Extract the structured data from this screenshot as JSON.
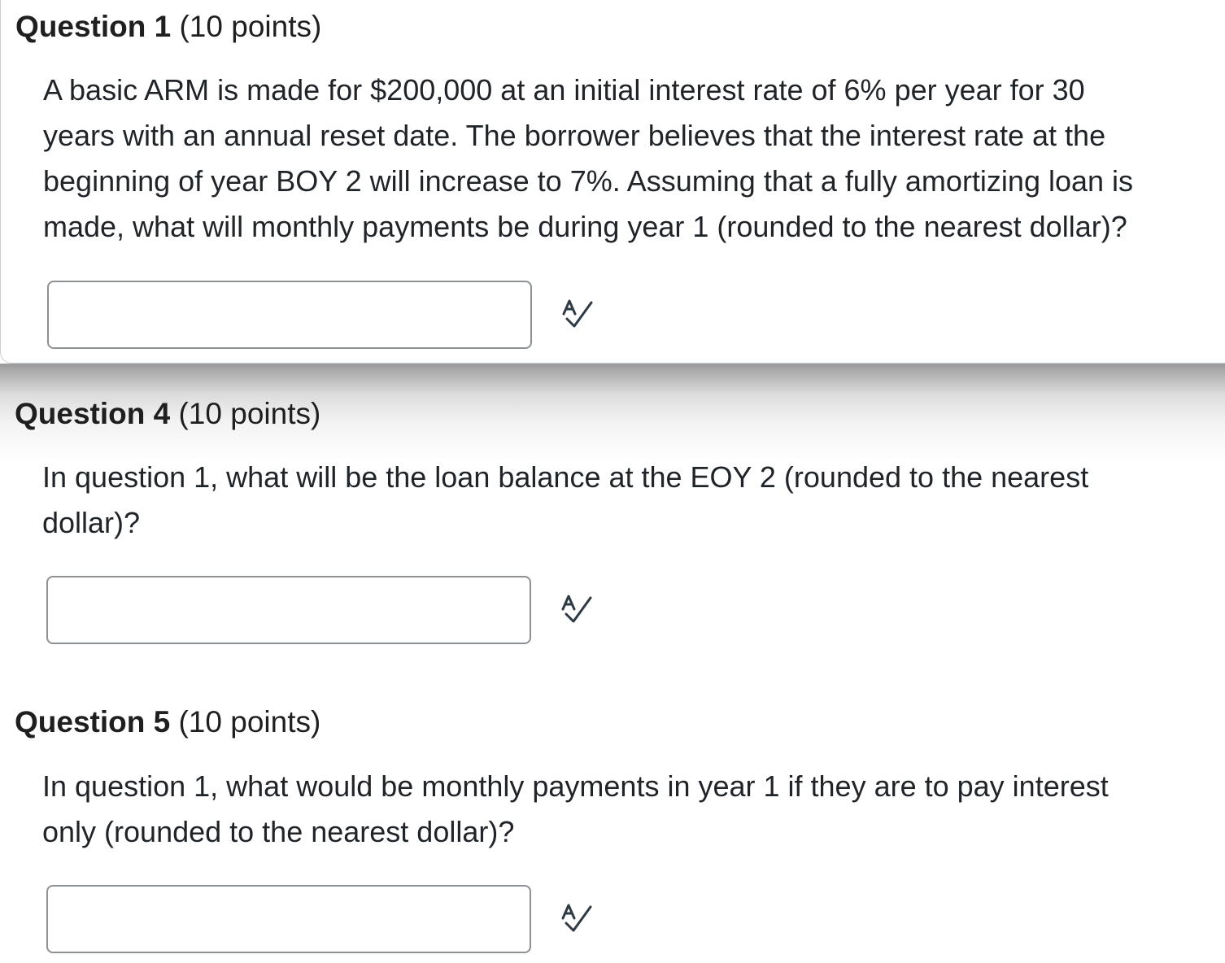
{
  "questions": [
    {
      "label": "Question 1",
      "points": "(10 points)",
      "lines": [
        "A basic ARM is made for $200,000 at an initial interest rate of 6% per year for 30",
        "years with an annual reset date.  The borrower believes that the interest rate at the",
        "beginning of year BOY 2 will increase to 7%.  Assuming that a fully amortizing loan is",
        "made, what will monthly payments be during year 1 (rounded to the nearest dollar)?"
      ],
      "answer_value": ""
    },
    {
      "label": "Question 4",
      "points": "(10 points)",
      "lines": [
        "In question 1, what will be the loan balance at the EOY 2 (rounded to the nearest",
        "dollar)?"
      ],
      "answer_value": ""
    },
    {
      "label": "Question 5",
      "points": "(10 points)",
      "lines": [
        "In question 1, what would be monthly payments in year 1 if they are to pay interest",
        "only (rounded to the nearest dollar)?"
      ],
      "answer_value": ""
    }
  ],
  "icons": {
    "spell_check": "spell-check-icon"
  },
  "colors": {
    "text": "#1f2428",
    "input_border": "#8b9196",
    "icon": "#2d3b45"
  }
}
